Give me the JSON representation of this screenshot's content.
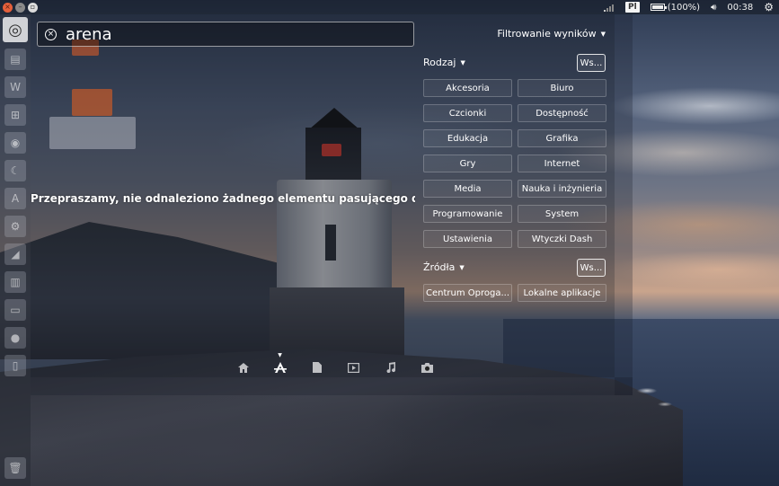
{
  "top_panel": {
    "keyboard_layout": "Pl",
    "battery_text": "(100%)",
    "time": "00:38",
    "icons": [
      "signal-icon",
      "battery-icon",
      "volume-icon",
      "gear-icon"
    ]
  },
  "launcher": {
    "items": [
      "dash-home-icon",
      "files-icon",
      "writer-icon",
      "calc-icon",
      "browser-icon",
      "moon-icon",
      "software-center-icon",
      "settings-icon",
      "draw-icon",
      "folder-icon",
      "terminal-icon",
      "disc-icon",
      "usb-icon",
      "trash-icon"
    ]
  },
  "search": {
    "value": "arena"
  },
  "no_results_message": "Przepraszamy, nie odnaleziono żadnego elementu pasującego do kryteri",
  "filters": {
    "toggle_label": "Filtrowanie wyników",
    "type_section": {
      "label": "Rodzaj",
      "all_label": "Ws...",
      "options": [
        "Akcesoria",
        "Biuro",
        "Czcionki",
        "Dostępność",
        "Edukacja",
        "Grafika",
        "Gry",
        "Internet",
        "Media",
        "Nauka i inżynieria",
        "Programowanie",
        "System",
        "Ustawienia",
        "Wtyczki Dash"
      ]
    },
    "sources_section": {
      "label": "Źródła",
      "all_label": "Ws...",
      "options": [
        "Centrum Oproga...",
        "Lokalne aplikacje"
      ]
    }
  },
  "lenses": [
    "home-lens-icon",
    "applications-lens-icon",
    "files-lens-icon",
    "video-lens-icon",
    "music-lens-icon",
    "photo-lens-icon"
  ],
  "active_lens": "applications-lens-icon"
}
